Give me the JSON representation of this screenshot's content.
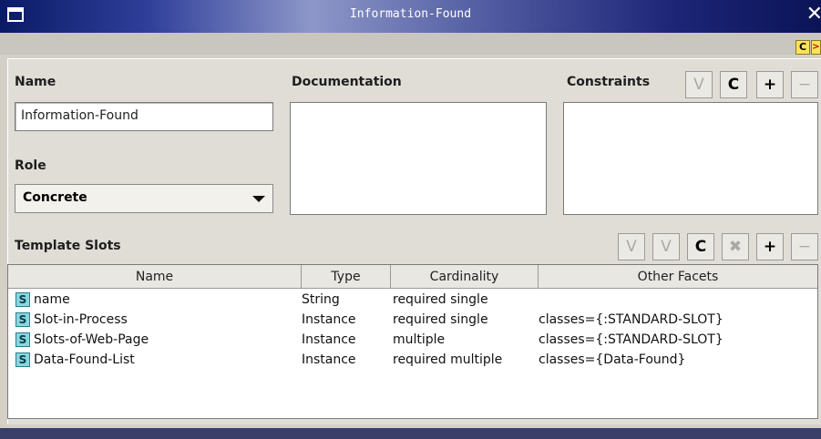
{
  "window": {
    "title": "Information-Found"
  },
  "badges": {
    "c": "C",
    "arrow": ">"
  },
  "name_section": {
    "label": "Name",
    "value": "Information-Found"
  },
  "role_section": {
    "label": "Role",
    "value": "Concrete"
  },
  "documentation": {
    "label": "Documentation"
  },
  "constraints": {
    "label": "Constraints",
    "buttons": {
      "v": "V",
      "c": "C",
      "plus": "+",
      "minus": "−"
    }
  },
  "template_slots": {
    "label": "Template Slots",
    "buttons": {
      "v1": "V",
      "v2": "V",
      "c": "C",
      "x": "✖",
      "plus": "+",
      "minus": "−"
    },
    "columns": [
      "Name",
      "Type",
      "Cardinality",
      "Other Facets"
    ],
    "rows": [
      {
        "icon": "S",
        "name": "name",
        "type": "String",
        "cardinality": "required single",
        "facets": ""
      },
      {
        "icon": "S",
        "name": "Slot-in-Process",
        "type": "Instance",
        "cardinality": "required single",
        "facets": "classes={:STANDARD-SLOT}"
      },
      {
        "icon": "S",
        "name": "Slots-of-Web-Page",
        "type": "Instance",
        "cardinality": "multiple",
        "facets": "classes={:STANDARD-SLOT}"
      },
      {
        "icon": "S",
        "name": "Data-Found-List",
        "type": "Instance",
        "cardinality": "required multiple",
        "facets": "classes={Data-Found}"
      }
    ]
  }
}
